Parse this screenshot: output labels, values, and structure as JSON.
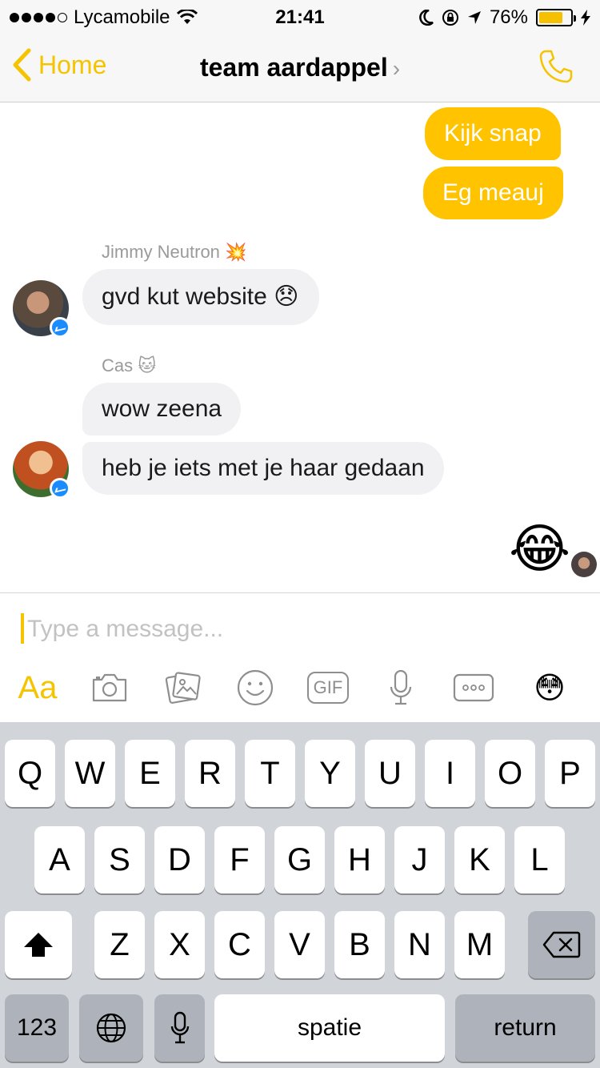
{
  "status_bar": {
    "carrier": "Lycamobile",
    "time": "21:41",
    "battery": "76%",
    "battery_level": 0.76,
    "signal_filled": 4,
    "signal_total": 5
  },
  "nav": {
    "back_label": "Home",
    "title": "team aardappel",
    "title_chevron": "›"
  },
  "messages": {
    "out_1": "Kijk snap",
    "out_2": "Eg meauj",
    "sender_1": "Jimmy Neutron",
    "sender_1_emoji": "💥",
    "in_1": "gvd kut website 😞",
    "sender_2": "Cas",
    "sender_2_emoji": "🐱",
    "in_2": "wow zeena",
    "in_3": "heb je iets met je haar gedaan",
    "out_3": "😂"
  },
  "composer": {
    "placeholder": "Type a message...",
    "aa_label": "Aa",
    "gif_label": "GIF",
    "emoji_button": "😳"
  },
  "keyboard": {
    "row1": [
      "Q",
      "W",
      "E",
      "R",
      "T",
      "Y",
      "U",
      "I",
      "O",
      "P"
    ],
    "row2": [
      "A",
      "S",
      "D",
      "F",
      "G",
      "H",
      "J",
      "K",
      "L"
    ],
    "row3": [
      "Z",
      "X",
      "C",
      "V",
      "B",
      "N",
      "M"
    ],
    "numbers_label": "123",
    "space_label": "spatie",
    "return_label": "return"
  },
  "colors": {
    "accent": "#ffc300",
    "incoming_bubble": "#f1f1f3",
    "messenger_badge": "#1a8cff",
    "keyboard_bg": "#d1d4d9"
  }
}
